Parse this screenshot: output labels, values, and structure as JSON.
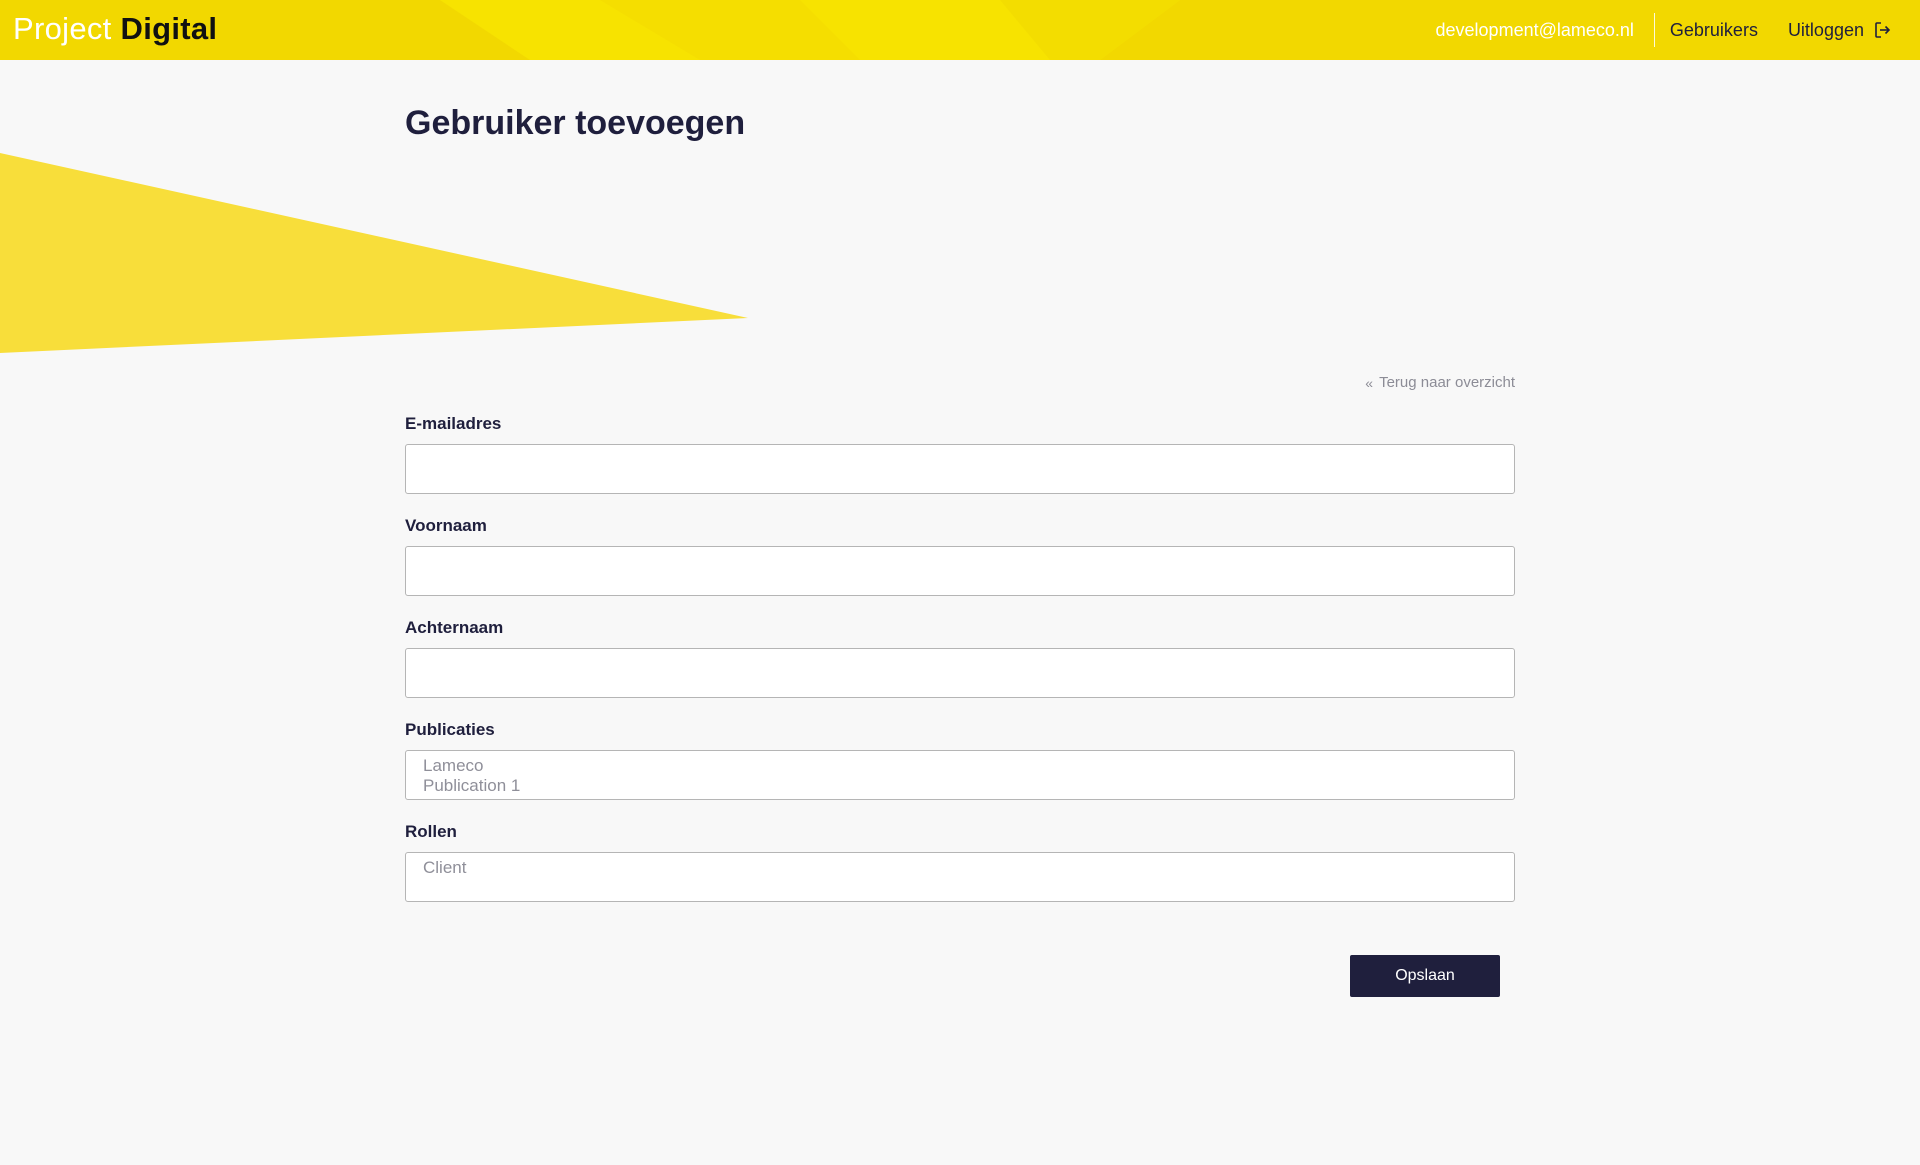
{
  "header": {
    "brand_light": "Project",
    "brand_bold": "Digital",
    "user_email": "development@lameco.nl",
    "nav_users": "Gebruikers",
    "nav_logout": "Uitloggen"
  },
  "main": {
    "title": "Gebruiker toevoegen",
    "back_link": "Terug naar overzicht",
    "fields": {
      "email": {
        "label": "E-mailadres",
        "value": ""
      },
      "first_name": {
        "label": "Voornaam",
        "value": ""
      },
      "last_name": {
        "label": "Achternaam",
        "value": ""
      },
      "publications": {
        "label": "Publicaties",
        "options": [
          "Lameco",
          "Publication 1"
        ]
      },
      "roles": {
        "label": "Rollen",
        "options": [
          "Client"
        ]
      }
    },
    "save_label": "Opslaan"
  },
  "icons": {
    "logout": "logout-icon",
    "back": "double-chevron-left-icon"
  },
  "colors": {
    "header_yellow": "#f2d800",
    "accent_yellow": "#f8de3a",
    "navy": "#1f1f3d",
    "background": "#f8f8f8"
  }
}
